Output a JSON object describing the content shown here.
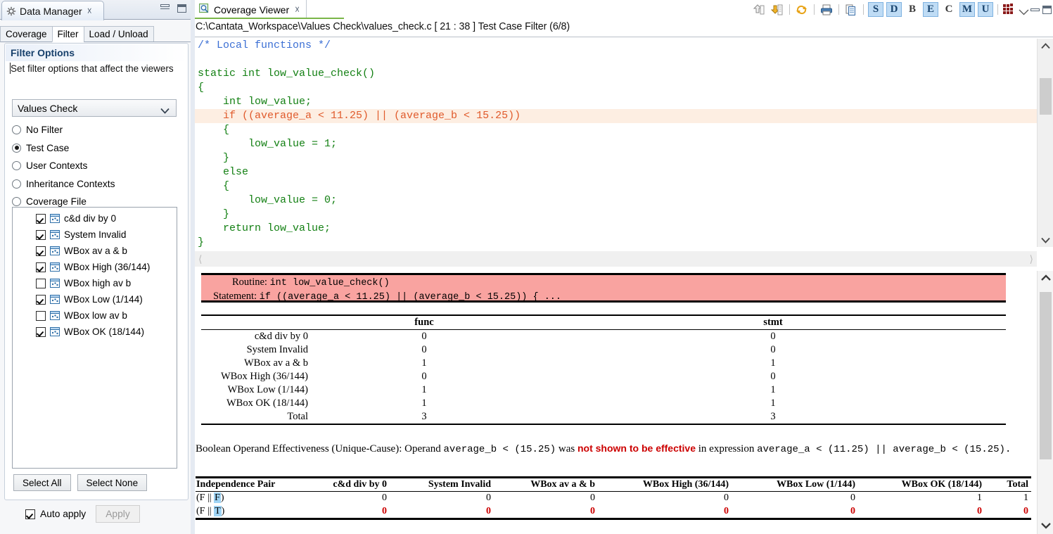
{
  "data_manager": {
    "tab_title": "Data Manager",
    "close_label": "☓",
    "sub_tabs": [
      {
        "label": "Coverage",
        "active": false
      },
      {
        "label": "Filter",
        "active": true
      },
      {
        "label": "Load / Unload",
        "active": false
      }
    ],
    "filter_options": {
      "title": "Filter Options",
      "description": "Set filter options that affect the viewers",
      "combo_value": "Values Check",
      "radios": [
        {
          "label": "No Filter",
          "selected": false
        },
        {
          "label": "Test Case",
          "selected": true
        },
        {
          "label": "User Contexts",
          "selected": false
        },
        {
          "label": "Inheritance Contexts",
          "selected": false
        },
        {
          "label": "Coverage File",
          "selected": false
        }
      ],
      "list_items": [
        {
          "label": "c&d div by 0",
          "checked": true
        },
        {
          "label": "System Invalid",
          "checked": true
        },
        {
          "label": "WBox av a & b",
          "checked": true
        },
        {
          "label": "WBox High (36/144)",
          "checked": true
        },
        {
          "label": "WBox high av b",
          "checked": false
        },
        {
          "label": "WBox Low (1/144)",
          "checked": true
        },
        {
          "label": "WBox low av b",
          "checked": false
        },
        {
          "label": "WBox OK (18/144)",
          "checked": true
        }
      ],
      "select_all": "Select All",
      "select_none": "Select None",
      "auto_apply": "Auto apply",
      "auto_apply_checked": true,
      "apply": "Apply"
    }
  },
  "coverage_viewer": {
    "tab_title": "Coverage Viewer",
    "close_label": "☓",
    "path_line": "C:\\Cantata_Workspace\\Values Check\\values_check.c  [ 21 : 38 ] Test Case Filter (6/8)",
    "toolbar": {
      "letters": [
        {
          "label": "S",
          "active": true
        },
        {
          "label": "D",
          "active": true
        },
        {
          "label": "B",
          "active": false
        },
        {
          "label": "E",
          "active": true
        },
        {
          "label": "C",
          "active": false
        },
        {
          "label": "M",
          "active": true
        },
        {
          "label": "U",
          "active": true
        }
      ]
    },
    "code_lines": [
      {
        "text": "/* Local functions */",
        "style": "comment",
        "highlight": false
      },
      {
        "text": "",
        "style": "plain",
        "highlight": false
      },
      {
        "text": "static int low_value_check()",
        "style": "code",
        "highlight": false
      },
      {
        "text": "{",
        "style": "code",
        "highlight": false
      },
      {
        "text": "    int low_value;",
        "style": "code",
        "highlight": false
      },
      {
        "text": "    if ((average_a < 11.25) || (average_b < 15.25))",
        "style": "code",
        "highlight": true
      },
      {
        "text": "    {",
        "style": "code",
        "highlight": false
      },
      {
        "text": "        low_value = 1;",
        "style": "code",
        "highlight": false
      },
      {
        "text": "    }",
        "style": "code",
        "highlight": false
      },
      {
        "text": "    else",
        "style": "code",
        "highlight": false
      },
      {
        "text": "    {",
        "style": "code",
        "highlight": false
      },
      {
        "text": "        low_value = 0;",
        "style": "code",
        "highlight": false
      },
      {
        "text": "    }",
        "style": "code",
        "highlight": false
      },
      {
        "text": "    return low_value;",
        "style": "code",
        "highlight": false
      },
      {
        "text": "}",
        "style": "code",
        "highlight": false
      }
    ],
    "detail": {
      "routine_label": "Routine:",
      "routine_value": "int low_value_check()",
      "statement_label": "Statement:",
      "statement_value": "if ((average_a < 11.25) || (average_b < 15.25)) { ..."
    },
    "coverage_table": {
      "columns": [
        "",
        "func",
        "stmt"
      ],
      "rows": [
        {
          "name": "c&d div by 0",
          "func": "0",
          "stmt": "0"
        },
        {
          "name": "System Invalid",
          "func": "0",
          "stmt": "0"
        },
        {
          "name": "WBox av a & b",
          "func": "1",
          "stmt": "1"
        },
        {
          "name": "WBox High (36/144)",
          "func": "0",
          "stmt": "0"
        },
        {
          "name": "WBox Low (1/144)",
          "func": "1",
          "stmt": "1"
        },
        {
          "name": "WBox OK (18/144)",
          "func": "1",
          "stmt": "1"
        },
        {
          "name": "Total",
          "func": "3",
          "stmt": "3"
        }
      ]
    },
    "boolean_effectiveness": {
      "prefix": "Boolean Operand Effectiveness (Unique-Cause): Operand ",
      "operand": "average_b < (15.25)",
      "middle": " was ",
      "emphasis": "not shown to be effective",
      "middle2": " in expression ",
      "expression": "average_a < (11.25) || average_b < (15.25)",
      "suffix": "."
    },
    "independence_table": {
      "columns": [
        "Independence Pair",
        "c&d div by 0",
        "System Invalid",
        "WBox av a & b",
        "WBox High (36/144)",
        "WBox Low (1/144)",
        "WBox OK (18/144)",
        "Total"
      ],
      "rows": [
        {
          "pair_prefix": "(F || ",
          "pair_hl": "F",
          "pair_suffix": ")",
          "values": [
            "0",
            "0",
            "0",
            "0",
            "0",
            "1"
          ],
          "total": "1",
          "red": false
        },
        {
          "pair_prefix": "(F || ",
          "pair_hl": "T",
          "pair_suffix": ")",
          "values": [
            "0",
            "0",
            "0",
            "0",
            "0",
            "0"
          ],
          "total": "0",
          "red": true
        }
      ]
    }
  },
  "colors": {
    "accent": "#17406b",
    "highlight_row": "#fdeee2",
    "pink_box": "#f9a3a0",
    "red_text": "#cc0000",
    "code_green": "#138013",
    "code_comment": "#3b6fd4",
    "code_orange": "#e05a2b",
    "toggle_active": "#bfdcf5",
    "cell_highlight": "#9fd4f5"
  }
}
